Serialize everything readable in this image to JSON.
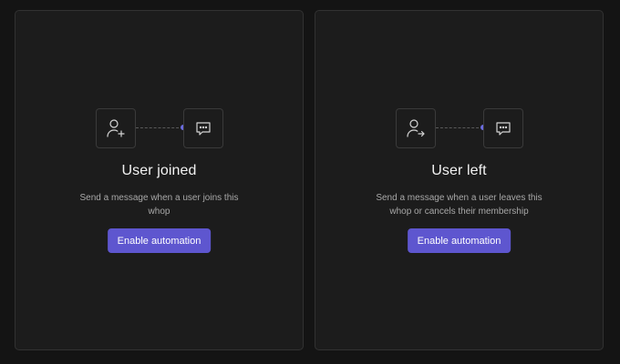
{
  "cards": [
    {
      "title": "User joined",
      "description": "Send a message when a user joins this whop",
      "button_label": "Enable automation",
      "trigger_icon": "user-plus-icon",
      "action_icon": "message-bubble-icon"
    },
    {
      "title": "User left",
      "description": "Send a message when a user leaves this whop or cancels their membership",
      "button_label": "Enable automation",
      "trigger_icon": "user-arrow-right-icon",
      "action_icon": "message-bubble-icon"
    }
  ],
  "colors": {
    "background": "#141414",
    "card": "#1c1c1c",
    "accent": "#5e56cf",
    "connector_dot": "#6b6ce0"
  }
}
